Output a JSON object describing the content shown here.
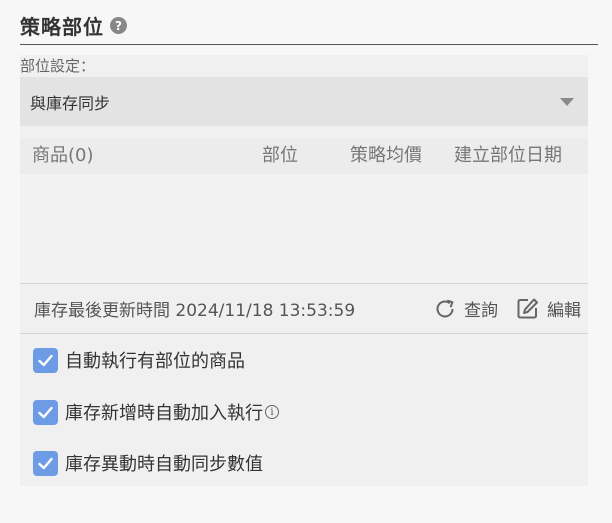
{
  "header": {
    "title": "策略部位",
    "help_icon": "question-circle-icon"
  },
  "settings": {
    "label": "部位設定：",
    "select_value": "與庫存同步",
    "dropdown_icon": "caret-down-icon"
  },
  "table": {
    "columns": [
      "商品(0)",
      "部位",
      "策略均價",
      "建立部位日期"
    ],
    "rows": []
  },
  "update": {
    "text": "庫存最後更新時間 2024/11/18 13:53:59",
    "query_label": "查詢",
    "query_icon": "refresh-icon",
    "edit_label": "編輯",
    "edit_icon": "edit-icon"
  },
  "options": [
    {
      "label": "自動執行有部位的商品",
      "checked": true
    },
    {
      "label": "庫存新增時自動加入執行",
      "checked": true,
      "info_icon": "info-circle-icon"
    },
    {
      "label": "庫存異動時自動同步數值",
      "checked": true
    }
  ],
  "colors": {
    "accent": "#6e9be6",
    "panel": "#f0f0f0",
    "select_bg": "#e3e3e3"
  }
}
